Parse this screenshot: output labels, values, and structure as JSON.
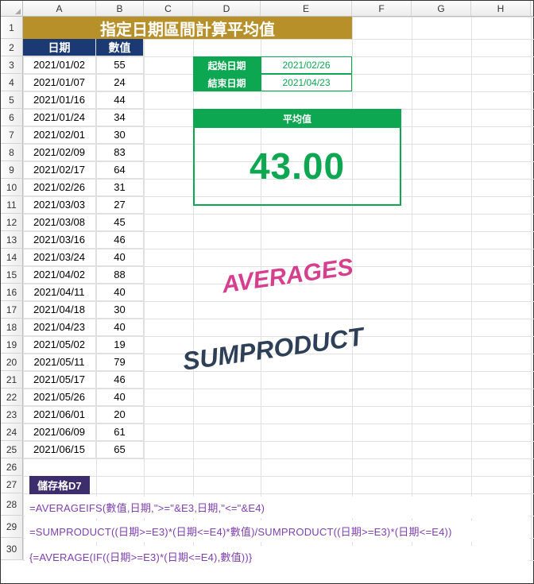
{
  "columns": [
    "A",
    "B",
    "C",
    "D",
    "E",
    "F",
    "G",
    "H"
  ],
  "banner": "指定日期區間計算平均值",
  "headers": {
    "date": "日期",
    "value": "數值"
  },
  "rows": [
    {
      "date": "2021/01/02",
      "val": 55
    },
    {
      "date": "2021/01/07",
      "val": 24
    },
    {
      "date": "2021/01/16",
      "val": 44
    },
    {
      "date": "2021/01/24",
      "val": 34
    },
    {
      "date": "2021/02/01",
      "val": 30
    },
    {
      "date": "2021/02/09",
      "val": 83
    },
    {
      "date": "2021/02/17",
      "val": 64
    },
    {
      "date": "2021/02/26",
      "val": 31
    },
    {
      "date": "2021/03/03",
      "val": 27
    },
    {
      "date": "2021/03/08",
      "val": 45
    },
    {
      "date": "2021/03/16",
      "val": 46
    },
    {
      "date": "2021/03/24",
      "val": 40
    },
    {
      "date": "2021/04/02",
      "val": 88
    },
    {
      "date": "2021/04/11",
      "val": 40
    },
    {
      "date": "2021/04/18",
      "val": 30
    },
    {
      "date": "2021/04/23",
      "val": 40
    },
    {
      "date": "2021/05/02",
      "val": 19
    },
    {
      "date": "2021/05/11",
      "val": 79
    },
    {
      "date": "2021/05/17",
      "val": 46
    },
    {
      "date": "2021/05/26",
      "val": 40
    },
    {
      "date": "2021/06/01",
      "val": 20
    },
    {
      "date": "2021/06/09",
      "val": 61
    },
    {
      "date": "2021/06/15",
      "val": 65
    }
  ],
  "params": {
    "start_label": "起始日期",
    "start_value": "2021/02/26",
    "end_label": "結束日期",
    "end_value": "2021/04/23"
  },
  "avg": {
    "label": "平均值",
    "value": "43.00"
  },
  "decorations": {
    "word1": "AVERAGES",
    "word2": "SUMPRODUCT"
  },
  "cellref": "儲存格D7",
  "formulas": [
    "=AVERAGEIFS(數值,日期,\">=\"&E3,日期,\"<=\"&E4)",
    "=SUMPRODUCT((日期>=E3)*(日期<=E4)*數值)/SUMPRODUCT((日期>=E3)*(日期<=E4))",
    "{=AVERAGE(IF((日期>=E3)*(日期<=E4),數值))}"
  ]
}
